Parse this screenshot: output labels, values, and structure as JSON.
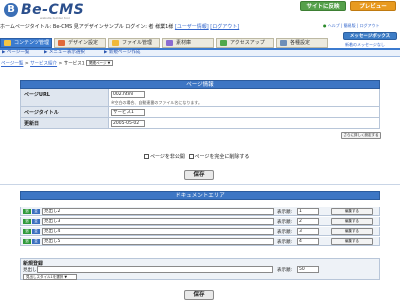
{
  "header": {
    "logo_text": "Be-CMS",
    "logo_mark": "B",
    "logo_sub": "website builder tool",
    "sync_label": "サイトに反映",
    "preview_label": "プレビュー"
  },
  "crumbline": {
    "text": "ホームページタイトル: Be-CMS 見アデザインサンプル  ログイン: 者 様業1様",
    "link1": "[ユーザー情報]",
    "link2": "[ログアウト]"
  },
  "help": {
    "help_label": "ヘルプ",
    "hyperlink_label": "簡易版",
    "logout_label": "ログアウト"
  },
  "message": {
    "box_label": "メッセージボックス",
    "link_label": "新着のメッセージなし"
  },
  "tabs": [
    {
      "label": "コンテンツ管理",
      "icon": "content-icon",
      "color": "#f5c542"
    },
    {
      "label": "デザイン設定",
      "icon": "design-icon",
      "color": "#e06a3a"
    },
    {
      "label": "ファイル管理",
      "icon": "folder-icon",
      "color": "#f0b93a"
    },
    {
      "label": "素材庫",
      "icon": "material-icon",
      "color": "#8a6bd1"
    },
    {
      "label": "アクセスアップ",
      "icon": "access-icon",
      "color": "#4fa84a"
    },
    {
      "label": "各種設定",
      "icon": "settings-icon",
      "color": "#6e8fb8"
    }
  ],
  "subnav": [
    {
      "label": "ページ一覧"
    },
    {
      "label": "メニュー表示選択"
    },
    {
      "label": "新規ページ作成"
    }
  ],
  "crumb2": {
    "link1": "ページ一覧",
    "link2": "サービス紹介",
    "current": "サービス1",
    "select": "関連ページ"
  },
  "page_info": {
    "title": "ページ情報",
    "page_url_label": "ページURL",
    "page_url_value": "002.html",
    "page_url_note": "※空白の場合、自動連番のファイル名になります。",
    "page_title_label": "ページタイトル",
    "page_title_value": "サービス1",
    "updated_label": "更新日",
    "updated_value": "2005-05-02",
    "advanced_button": "さらに詳しく設定する"
  },
  "options": {
    "hide_label": "ページを非公開",
    "delete_label": "ページを完全に削除する"
  },
  "save_label": "保存",
  "doc_area": {
    "title": "ドキュメントエリア",
    "tag_add": "追",
    "tag_sort": "並",
    "order_label": "表示順:",
    "edit_label": "編集する",
    "rows": [
      {
        "heading": "見出し2",
        "order": "1"
      },
      {
        "heading": "見出し3",
        "order": "2"
      },
      {
        "heading": "見出し4",
        "order": "3"
      },
      {
        "heading": "見出し5",
        "order": "4"
      }
    ],
    "new_title": "新規登録",
    "new_heading": "見出し1",
    "new_order": "50",
    "new_select": "見出しスタイル1を選択"
  }
}
